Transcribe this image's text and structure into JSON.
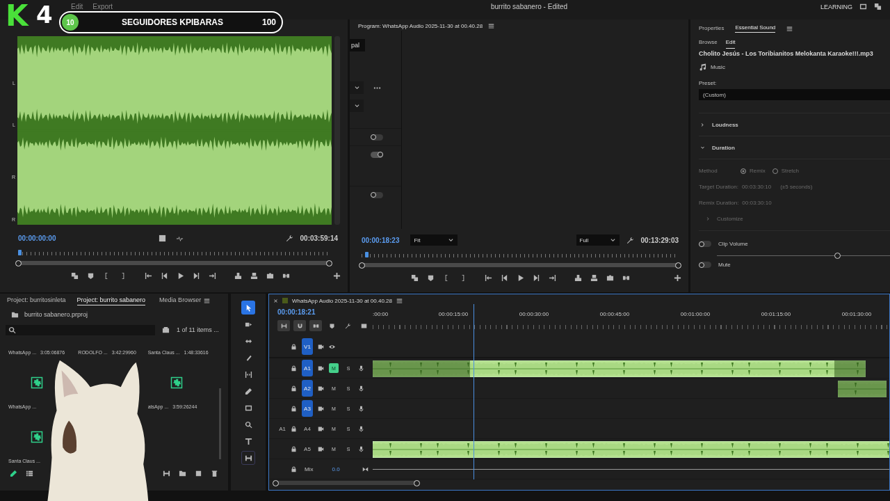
{
  "app": {
    "menu": [
      "Edit",
      "Export"
    ],
    "title": "burrito sabanero - Edited",
    "workspace": "LEARNING"
  },
  "overlay": {
    "logo": "K",
    "number": "4",
    "counter": {
      "current": "10",
      "label": "SEGUIDORES KPIBARAS",
      "goal": "100"
    }
  },
  "source_monitor": {
    "channel_labels": [
      "L",
      "L",
      "R",
      "R"
    ],
    "timecode": "00:00:00:00",
    "duration": "00:03:59:14",
    "playhead": {
      "level": 0
    }
  },
  "program_monitor": {
    "title": "Program: WhatsApp Audio 2025-11-30 at 00.40.28",
    "side_button": "pal",
    "toggles": [
      {
        "on": false
      },
      {
        "on": true
      },
      {
        "on": false
      }
    ],
    "timecode": "00:00:18:23",
    "zoom": "Fit",
    "quality": "Full",
    "duration": "00:13:29:03",
    "playhead": {
      "level": 0.012
    }
  },
  "essential_sound": {
    "tabs": [
      {
        "label": "Properties",
        "selected": false
      },
      {
        "label": "Essential Sound",
        "selected": true
      }
    ],
    "subtabs": [
      {
        "label": "Browse",
        "selected": false
      },
      {
        "label": "Edit",
        "selected": true
      }
    ],
    "clip_name": "Cholito Jesús - Los Toribianitos  Melokanta Karaoke!!!.mp3",
    "type": "Music",
    "preset_label": "Preset:",
    "preset": "(Custom)",
    "sections": [
      {
        "label": "Loudness",
        "expanded": false
      },
      {
        "label": "Duration",
        "expanded": true
      }
    ],
    "duration": {
      "disabled": true,
      "method_label": "Method",
      "methods": [
        {
          "label": "Remix",
          "selected": true
        },
        {
          "label": "Stretch",
          "selected": false
        }
      ],
      "target_label": "Target Duration:",
      "target": "00:03:30:10",
      "tolerance": "(±5 seconds)",
      "remix_label": "Remix Duration:",
      "remix": "00:03:30:10",
      "customize": "Customize"
    },
    "clip_volume": {
      "label": "Clip Volume",
      "on": false,
      "level": 0.58
    },
    "mute": {
      "label": "Mute",
      "on": false
    }
  },
  "project": {
    "tabs": [
      {
        "label": "Project: burritosinleta",
        "selected": false
      },
      {
        "label": "Project: burrito sabanero",
        "selected": true
      },
      {
        "label": "Media Browser",
        "selected": false
      }
    ],
    "file": "burrito sabanero.prproj",
    "count": "1 of 11 items ...",
    "rows": [
      [
        {
          "kind": "audio",
          "name": "WhatsApp ...",
          "duration": "3:05:06876"
        },
        {
          "kind": "audio",
          "name": "RODOLFO ...",
          "duration": "3:42:29960"
        },
        {
          "kind": "audio",
          "name": "Santa Claus ...",
          "duration": "1:48:33616"
        }
      ],
      [
        {
          "kind": "audio",
          "name": "WhatsApp ..."
        },
        {
          "kind": "covered"
        },
        {
          "kind": "audio",
          "name": "atsApp ...",
          "duration": "3:59:26244"
        }
      ],
      [
        {
          "kind": "audio",
          "name": "Santa Claus ..."
        }
      ]
    ]
  },
  "tools": [
    {
      "selected": true
    },
    {
      "selected": false
    },
    {
      "selected": false
    },
    {
      "selected": false
    },
    {
      "selected": false
    },
    {
      "selected": false
    },
    {
      "selected": false
    },
    {
      "selected": false
    },
    {
      "selected": false
    },
    {
      "selected": false
    }
  ],
  "timeline": {
    "tab": "WhatsApp Audio 2025-11-30 at 00.40.28",
    "timecode": "00:00:18:21",
    "ruler": [
      ":00:00",
      "00:00:15:00",
      "00:00:30:00",
      "00:00:45:00",
      "00:01:00:00",
      "00:01:15:00",
      "00:01:30:00"
    ],
    "playhead": {
      "level": 0.195
    },
    "tracks": [
      {
        "kind": "video",
        "label": "V1",
        "targeted": true
      },
      {
        "kind": "audio",
        "label": "A1",
        "targeted": true,
        "m": "M",
        "s": "S",
        "muted": true
      },
      {
        "kind": "audio",
        "label": "A2",
        "targeted": true,
        "m": "M",
        "s": "S",
        "muted": false
      },
      {
        "kind": "audio",
        "label": "A3",
        "targeted": true,
        "m": "M",
        "s": "S",
        "muted": false
      },
      {
        "kind": "audio",
        "label": "A4",
        "source": "A1",
        "targeted": false,
        "m": "M",
        "s": "S",
        "muted": false
      },
      {
        "kind": "audio",
        "label": "A5",
        "targeted": false,
        "m": "M",
        "s": "S",
        "muted": false
      }
    ],
    "mix": {
      "label": "Mix",
      "value": "0.0"
    }
  }
}
